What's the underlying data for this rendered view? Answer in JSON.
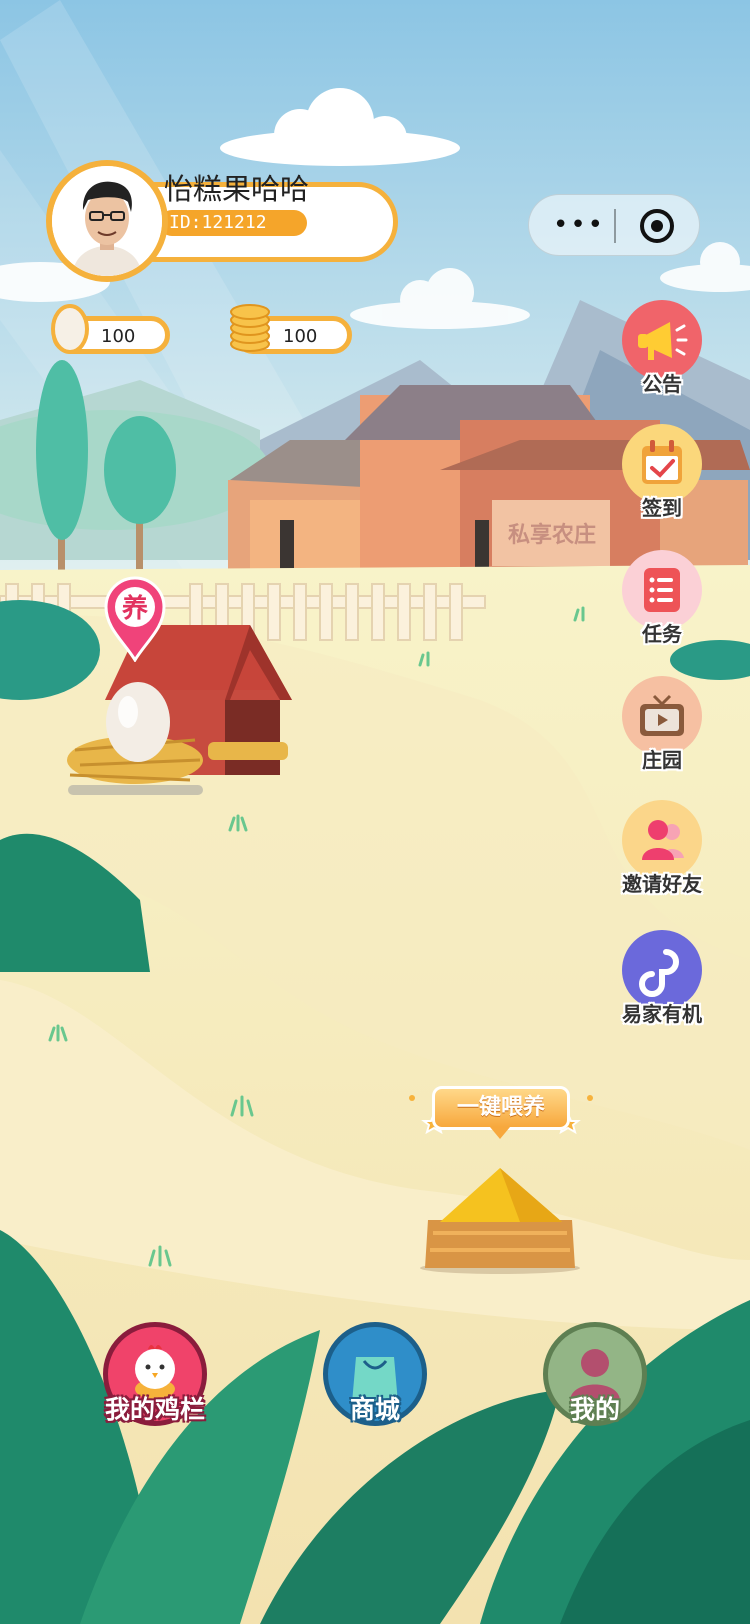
{
  "profile": {
    "name": "怡糕果哈哈",
    "id_text": "ID:121212"
  },
  "counters": {
    "eggs": "100",
    "coins": "100"
  },
  "capsule": {
    "more": "•••"
  },
  "farm_sign": "私享农庄",
  "coop_pin": "养",
  "side_menu": [
    {
      "label": "公告",
      "icon": "megaphone-icon"
    },
    {
      "label": "签到",
      "icon": "calendar-check-icon"
    },
    {
      "label": "任务",
      "icon": "task-list-icon"
    },
    {
      "label": "庄园",
      "icon": "tv-play-icon"
    },
    {
      "label": "邀请好友",
      "icon": "invite-friends-icon"
    },
    {
      "label": "易家有机",
      "icon": "link-icon"
    }
  ],
  "feed_button": "一键喂养",
  "bottom_nav": [
    {
      "label": "我的鸡栏",
      "icon": "chicken-icon"
    },
    {
      "label": "商城",
      "icon": "shopping-bag-icon"
    },
    {
      "label": "我的",
      "icon": "user-icon"
    }
  ],
  "colors": {
    "accent": "#f5b13c",
    "sky": "#8fc8e6",
    "ground": "#f4e7bc",
    "leaf": "#1f8a6b"
  }
}
